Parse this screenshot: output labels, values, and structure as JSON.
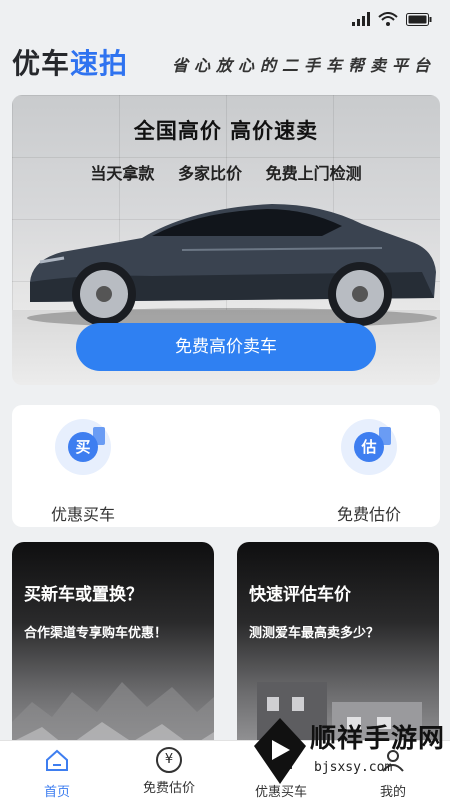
{
  "header": {
    "logo_part1": "优车",
    "logo_part2": "速拍",
    "slogan": "省心放心的二手车帮卖平台"
  },
  "hero": {
    "title": "全国高价  高价速卖",
    "features": "当天拿款 多家比价 免费上门检测",
    "cta": "免费高价卖车"
  },
  "quick_actions": [
    {
      "icon_char": "买",
      "label": "优惠买车",
      "icon": "buy-car-icon"
    },
    {
      "icon_char": "估",
      "label": "免费估价",
      "icon": "estimate-icon"
    }
  ],
  "cards": [
    {
      "title": "买新车或置换？",
      "subtitle": "合作渠道专享购车优惠！"
    },
    {
      "title": "快速评估车价",
      "subtitle": "测测爱车最高卖多少？"
    }
  ],
  "tabs": [
    {
      "label": "首页",
      "icon": "home-icon",
      "active": true
    },
    {
      "label": "免费估价",
      "icon": "yen-icon",
      "active": false
    },
    {
      "label": "优惠买车",
      "icon": "car-icon",
      "active": false
    },
    {
      "label": "我的",
      "icon": "user-icon",
      "active": false
    }
  ],
  "tab_icon_glyphs": {
    "yen": "¥"
  },
  "watermark": {
    "text": "顺祥手游网",
    "url": "bjsxsy.com"
  },
  "colors": {
    "accent": "#2f80f2",
    "active_tab": "#3e7ef0",
    "background": "#eef0f2"
  }
}
